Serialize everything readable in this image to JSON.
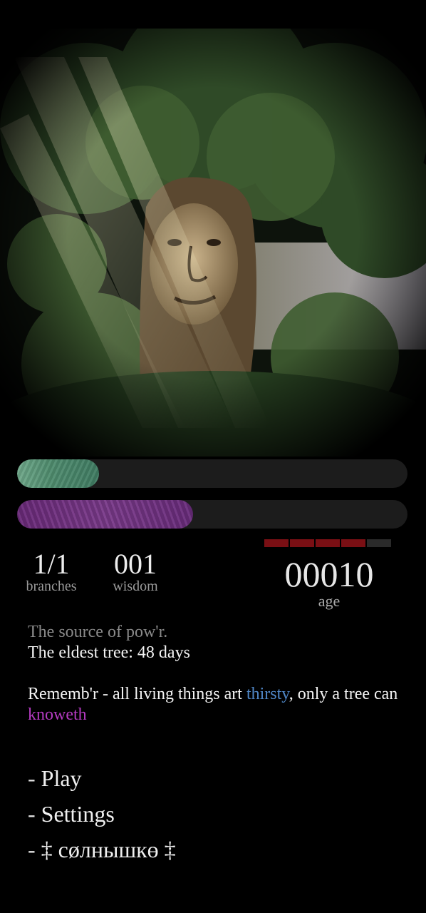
{
  "hero": {
    "icon": "wise-tree-portrait"
  },
  "bars": {
    "water_fill": 0.21,
    "wisdom_fill": 0.45,
    "water_color": "#4f8c6e",
    "wisdom_color": "#7a3a8a"
  },
  "stats": {
    "branches": {
      "value": "1/1",
      "label": "branches"
    },
    "wisdom": {
      "value": "001",
      "label": "wisdom"
    },
    "age": {
      "value": "00010",
      "label": "age",
      "meter_segments_total": 5,
      "meter_segments_filled": 4,
      "meter_color": "#7a0f14"
    }
  },
  "lore": {
    "subtitle": "The source of pow'r.",
    "eldest": "The eldest tree: 48 days",
    "quote_part1": "Rememb'r - all living things art ",
    "quote_keyword1": "thirsty",
    "quote_part2": ", only a tree can ",
    "quote_keyword2": "knoweth",
    "keyword1_color": "#4f86c6",
    "keyword2_color": "#b53bc2"
  },
  "menu": {
    "dash": "-",
    "items": [
      {
        "label": "Play"
      },
      {
        "label": "Settings"
      },
      {
        "label": "‡ cøлнышкө ‡"
      }
    ]
  }
}
